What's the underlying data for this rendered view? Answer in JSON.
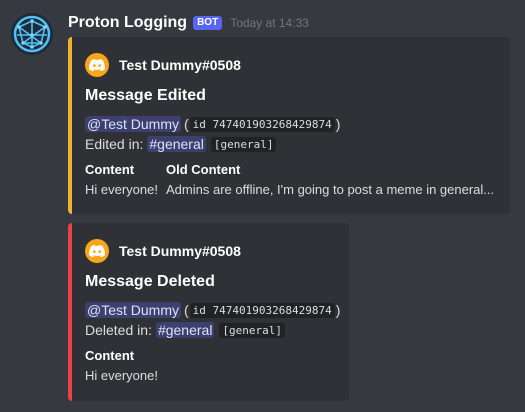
{
  "message": {
    "username": "Proton Logging",
    "bot_tag": "BOT",
    "timestamp": "Today at 14:33",
    "avatar_icon": "globe-network-icon"
  },
  "embeds": [
    {
      "accent": "#f0b232",
      "author": "Test Dummy#0508",
      "author_icon": "discord-icon",
      "title": "Message Edited",
      "mention": "@Test Dummy",
      "paren_open": "(",
      "user_id": "id 747401903268429874",
      "paren_close": ")",
      "channel_prefix": "Edited in:",
      "channel": "#general",
      "channel_code": "[general]",
      "fields": [
        {
          "name": "Content",
          "value": "Hi everyone!"
        },
        {
          "name": "Old Content",
          "value": "Admins are offline, I'm going to post a meme in general..."
        }
      ]
    },
    {
      "accent": "#ed4245",
      "author": "Test Dummy#0508",
      "author_icon": "discord-icon",
      "title": "Message Deleted",
      "mention": "@Test Dummy",
      "paren_open": "(",
      "user_id": "id 747401903268429874",
      "paren_close": ")",
      "channel_prefix": "Deleted in:",
      "channel": "#general",
      "channel_code": "[general]",
      "fields": [
        {
          "name": "Content",
          "value": "Hi everyone!"
        }
      ]
    }
  ]
}
